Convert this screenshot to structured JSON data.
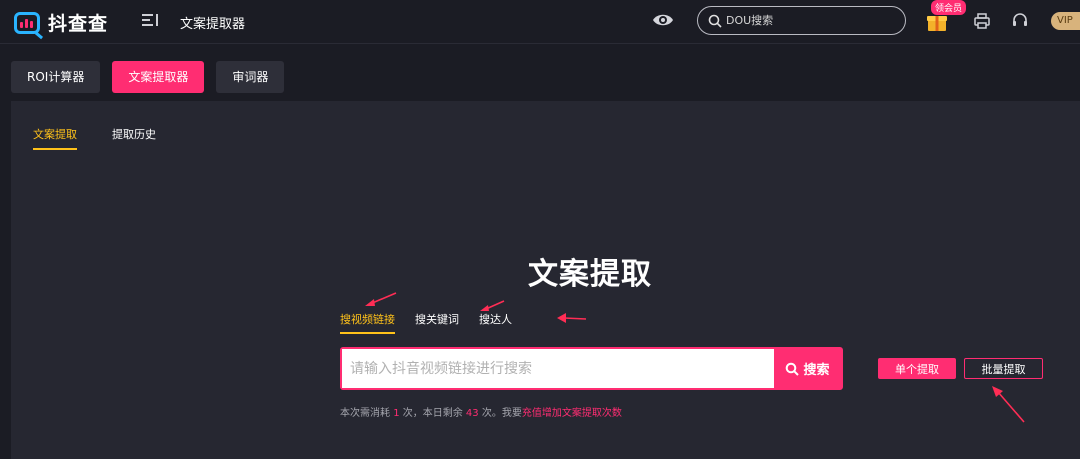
{
  "header": {
    "logo_text": "抖查查",
    "app_title": "文案提取器",
    "search_placeholder": "DOU搜索",
    "gift_badge": "领会员",
    "vip_label": "VIP",
    "icons": [
      "menu-icon",
      "eye-icon",
      "search-icon",
      "gift-icon",
      "printer-icon",
      "headset-icon"
    ]
  },
  "tool_tabs": [
    {
      "label": "ROI计算器",
      "active": false
    },
    {
      "label": "文案提取器",
      "active": true
    },
    {
      "label": "审词器",
      "active": false
    }
  ],
  "sub_tabs": [
    {
      "label": "文案提取",
      "active": true
    },
    {
      "label": "提取历史",
      "active": false
    }
  ],
  "main": {
    "title": "文案提取",
    "mode_tabs": [
      {
        "label": "搜视频链接",
        "active": true
      },
      {
        "label": "搜关键词",
        "active": false
      },
      {
        "label": "搜达人",
        "active": false
      }
    ],
    "input_placeholder": "请输入抖音视频链接进行搜索",
    "search_button": "搜索",
    "single_button": "单个提取",
    "batch_button": "批量提取",
    "note": {
      "p1": "本次需消耗 ",
      "cost": "1",
      "p2": " 次，本日剩余 ",
      "remain": "43",
      "p3": " 次。我要",
      "link": "充值增加文案提取次数"
    }
  },
  "colors": {
    "accent": "#ff2d72",
    "active_tab": "#ffc21a",
    "background": "#1b1c24",
    "panel": "#262731",
    "annotation_arrow": "#ff2d55"
  }
}
